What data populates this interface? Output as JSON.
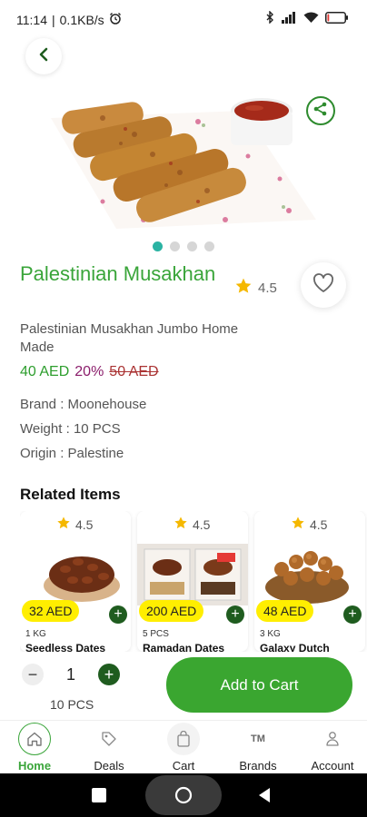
{
  "status": {
    "time": "11:14",
    "network_speed": "0.1KB/s",
    "separator": "|",
    "icons": [
      "alarm-icon",
      "bluetooth-icon",
      "signal-icon",
      "wifi-icon",
      "battery-icon"
    ],
    "battery_level": 0.1
  },
  "product": {
    "title": "Palestinian Musakhan",
    "rating": "4.5",
    "description": "Palestinian Musakhan Jumbo Home Made",
    "price": "40 AED",
    "discount": "20%",
    "old_price": "50 AED",
    "image_count": 4,
    "active_image": 0,
    "details": [
      {
        "label": "Brand",
        "value": "Moonehouse"
      },
      {
        "label": "Weight",
        "value": "10 PCS"
      },
      {
        "label": "Origin",
        "value": "Palestine"
      }
    ]
  },
  "related": {
    "title": "Related Items",
    "items": [
      {
        "rating": "4.5",
        "price": "32 AED",
        "unit": "1 KG",
        "name": "Seedless Dates"
      },
      {
        "rating": "4.5",
        "price": "200 AED",
        "unit": "5 PCS",
        "name": "Ramadan Dates"
      },
      {
        "rating": "4.5",
        "price": "48 AED",
        "unit": "3 KG",
        "name": "Galaxy Dutch"
      }
    ]
  },
  "cart": {
    "quantity": "1",
    "unit_label": "10 PCS",
    "minus_label": "−",
    "plus_label": "+",
    "add_label": "Add to Cart"
  },
  "nav": {
    "items": [
      {
        "label": "Home",
        "icon": "home-icon",
        "active": true
      },
      {
        "label": "Deals",
        "icon": "tag-icon",
        "active": false
      },
      {
        "label": "Cart",
        "icon": "bag-icon",
        "active": false
      },
      {
        "label": "Brands",
        "icon": "tm-icon",
        "glyph": "TM",
        "active": false
      },
      {
        "label": "Account",
        "icon": "user-icon",
        "active": false
      }
    ]
  },
  "colors": {
    "accent": "#3aa53a",
    "add_to_cart": "#3aa630",
    "price_badge": "#ffee00",
    "plus_button": "#1f5c1f",
    "discount": "#8b1d6b",
    "old_price": "#aa3333",
    "star": "#f5b800"
  }
}
